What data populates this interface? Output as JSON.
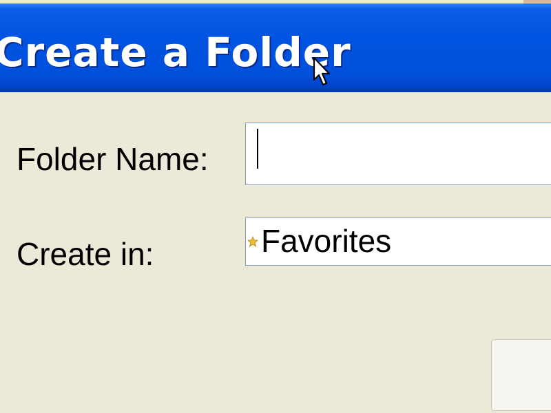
{
  "window": {
    "title": "Create a Folder"
  },
  "form": {
    "folder_name_label": "Folder Name:",
    "folder_name_value": "",
    "create_in_label": "Create in:",
    "create_in_value": "Favorites",
    "create_in_icon": "star-icon"
  },
  "buttons": {
    "ok_label": ""
  },
  "colors": {
    "titlebar": "#0053e0",
    "background": "#ece9d8",
    "input_border": "#7f9db9"
  }
}
